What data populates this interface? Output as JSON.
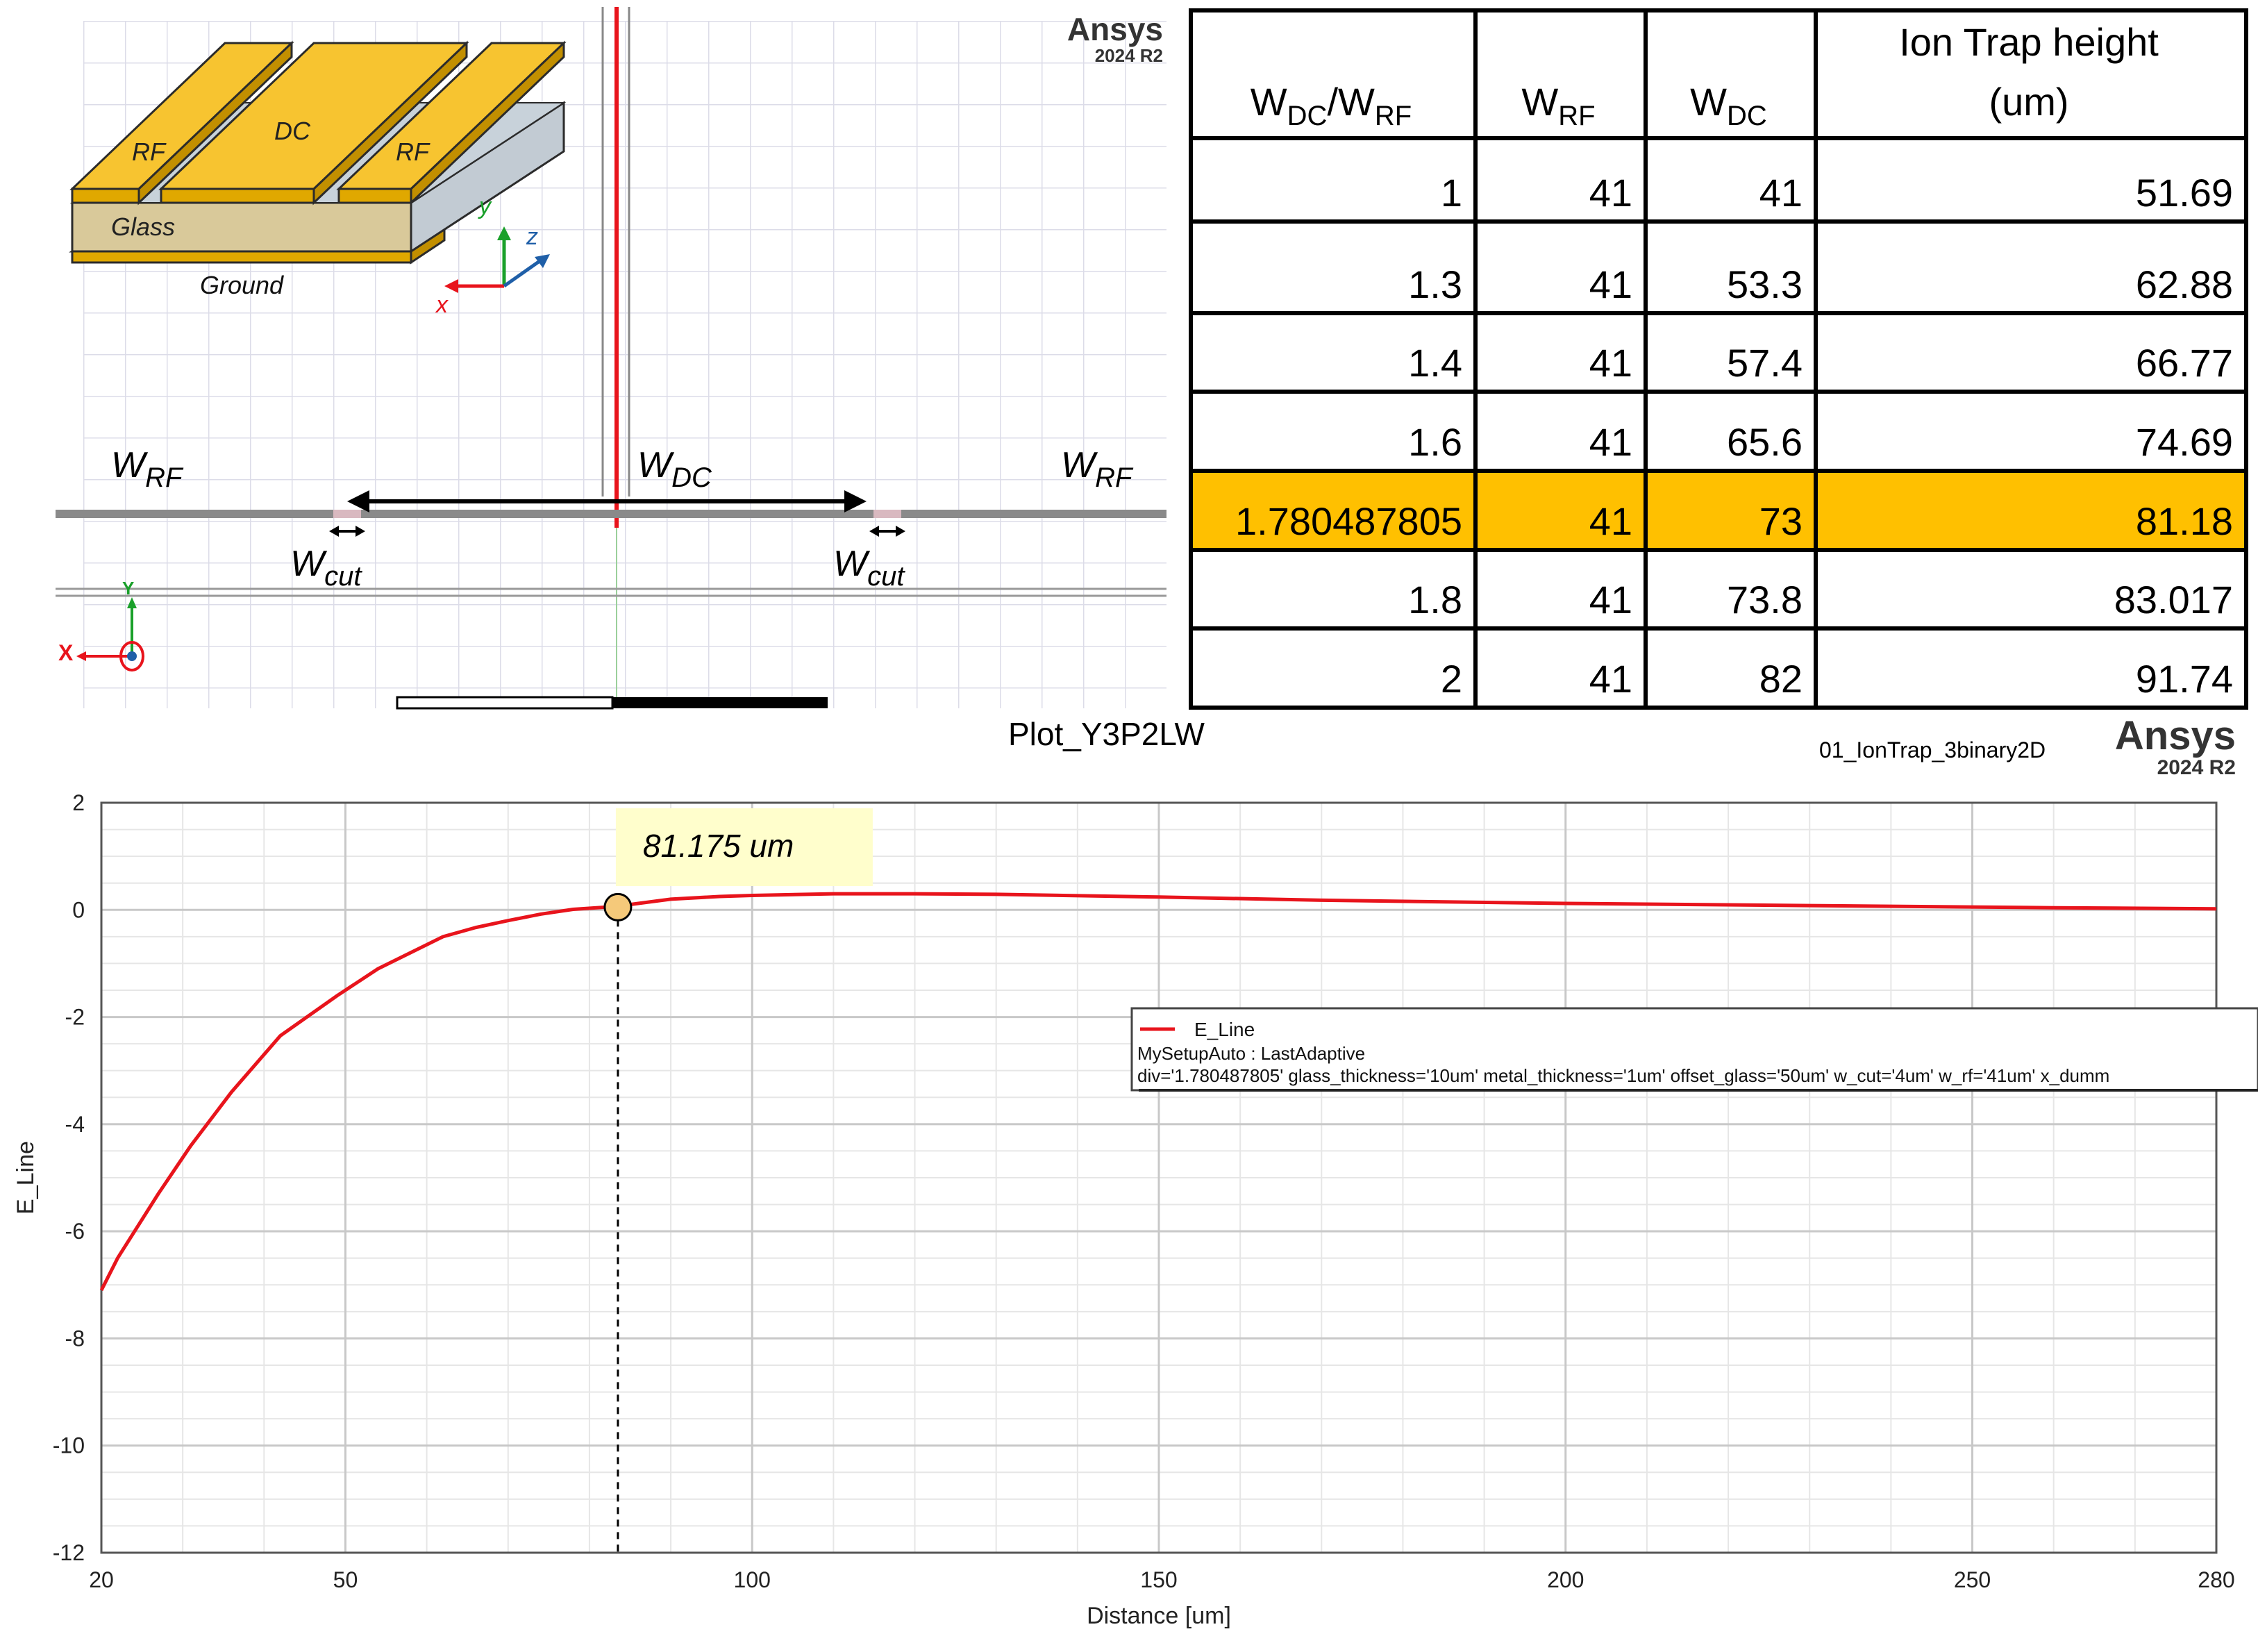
{
  "geometry_view": {
    "brand": "Ansys",
    "version": "2024 R2",
    "inset": {
      "labels": [
        "RF",
        "DC",
        "RF"
      ],
      "glass": "Glass",
      "ground": "Ground",
      "axis_x": "x",
      "axis_y": "y",
      "axis_z": "z"
    },
    "dim_labels": {
      "w_rf_left": "W",
      "w_rf_left_sub": "RF",
      "w_dc": "W",
      "w_dc_sub": "DC",
      "w_rf_right": "W",
      "w_rf_right_sub": "RF",
      "w_cut_left": "W",
      "w_cut_left_sub": "cut",
      "w_cut_right": "W",
      "w_cut_right_sub": "cut"
    },
    "triad": {
      "x": "X",
      "y": "Y"
    }
  },
  "table": {
    "headers": {
      "ratio_w": "W",
      "ratio_dc": "DC",
      "ratio_slash": "/W",
      "ratio_rf": "RF",
      "wrf_w": "W",
      "wrf_sub": "RF",
      "wdc_w": "W",
      "wdc_sub": "DC",
      "height_l1": "Ion Trap height",
      "height_l2": "(um)"
    },
    "rows": [
      [
        "1",
        "41",
        "41",
        "51.69"
      ],
      [
        "1.3",
        "41",
        "53.3",
        "62.88"
      ],
      [
        "1.4",
        "41",
        "57.4",
        "66.77"
      ],
      [
        "1.6",
        "41",
        "65.6",
        "74.69"
      ],
      [
        "1.780487805",
        "41",
        "73",
        "81.18"
      ],
      [
        "1.8",
        "41",
        "73.8",
        "83.017"
      ],
      [
        "2",
        "41",
        "82",
        "91.74"
      ]
    ],
    "highlight_row": 4,
    "highlight_color": "#FFC000"
  },
  "plot_header": {
    "title": "Plot_Y3P2LW",
    "project": "01_IonTrap_3binary2D",
    "brand": "Ansys",
    "version": "2024 R2"
  },
  "chart_data": {
    "type": "line",
    "title": "Plot_Y3P2LW",
    "xlabel": "Distance [um]",
    "ylabel": "E_Line",
    "xlim": [
      20,
      280
    ],
    "ylim": [
      -12,
      2
    ],
    "xticks": [
      20,
      50,
      100,
      150,
      200,
      250,
      280
    ],
    "yticks": [
      2,
      0,
      -2,
      -4,
      -6,
      -8,
      -10,
      -12
    ],
    "grid": true,
    "series": [
      {
        "name": "E_Line",
        "color": "#e8141c",
        "x": [
          20,
          22,
          27,
          31,
          36,
          42,
          49,
          54,
          58,
          62,
          66,
          70,
          74,
          78,
          82,
          84,
          86,
          90,
          96,
          100,
          110,
          120,
          130,
          150,
          170,
          200,
          230,
          260,
          280
        ],
        "y": [
          -7.1,
          -6.5,
          -5.3,
          -4.4,
          -3.4,
          -2.35,
          -1.6,
          -1.1,
          -0.8,
          -0.5,
          -0.33,
          -0.2,
          -0.08,
          0.01,
          0.05,
          0.08,
          0.12,
          0.2,
          0.25,
          0.27,
          0.3,
          0.3,
          0.29,
          0.24,
          0.18,
          0.12,
          0.08,
          0.04,
          0.02
        ]
      }
    ],
    "marker": {
      "x": 83.5,
      "y": 0.05,
      "label": "81.175 um"
    },
    "legend": {
      "position": "right",
      "name": "E_Line",
      "setup": "MySetupAuto : LastAdaptive",
      "params": "div='1.780487805' glass_thickness='10um' metal_thickness='1um' offset_glass='50um' w_cut='4um' w_rf='41um' x_dumm"
    }
  }
}
